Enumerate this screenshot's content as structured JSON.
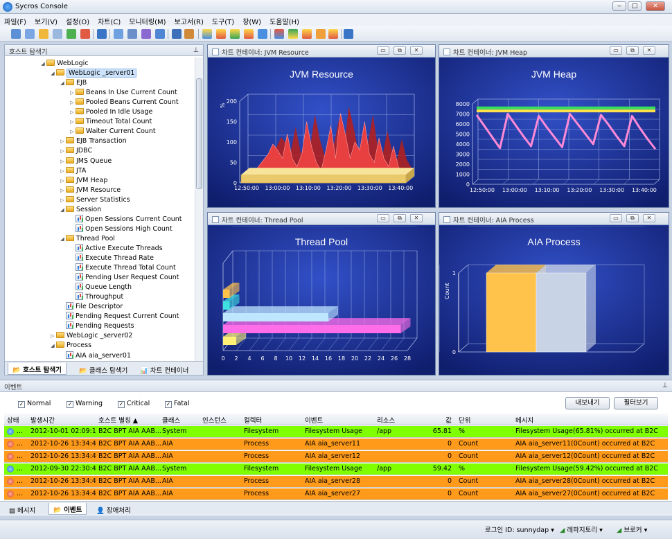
{
  "window": {
    "title": "Sycros Console"
  },
  "menu": [
    "파일(F)",
    "보기(V)",
    "설정(O)",
    "차트(C)",
    "모니터링(M)",
    "보고서(R)",
    "도구(T)",
    "창(W)",
    "도움말(H)"
  ],
  "host_panel": {
    "title": "호스트 탐색기",
    "tree": [
      {
        "label": "WebLogic",
        "depth": 0,
        "arrow": "◢",
        "icon": "folder"
      },
      {
        "label": "WebLogic _server01",
        "depth": 1,
        "arrow": "◢",
        "icon": "folder",
        "selected": true
      },
      {
        "label": "EJB",
        "depth": 2,
        "arrow": "◢",
        "icon": "folder"
      },
      {
        "label": "Beans In Use Current Count",
        "depth": 3,
        "arrow": "▷",
        "icon": "folder"
      },
      {
        "label": "Pooled Beans Current Count",
        "depth": 3,
        "arrow": "▷",
        "icon": "folder"
      },
      {
        "label": "Pooled In Idle Usage",
        "depth": 3,
        "arrow": "▷",
        "icon": "folder"
      },
      {
        "label": "Timeout Total Count",
        "depth": 3,
        "arrow": "▷",
        "icon": "folder"
      },
      {
        "label": "Waiter Current Count",
        "depth": 3,
        "arrow": "▷",
        "icon": "folder"
      },
      {
        "label": "EJB Transaction",
        "depth": 2,
        "arrow": "▷",
        "icon": "folder"
      },
      {
        "label": "JDBC",
        "depth": 2,
        "arrow": "▷",
        "icon": "folder"
      },
      {
        "label": "JMS Queue",
        "depth": 2,
        "arrow": "▷",
        "icon": "folder"
      },
      {
        "label": "JTA",
        "depth": 2,
        "arrow": "▷",
        "icon": "folder"
      },
      {
        "label": "JVM Heap",
        "depth": 2,
        "arrow": "▷",
        "icon": "folder"
      },
      {
        "label": "JVM Resource",
        "depth": 2,
        "arrow": "▷",
        "icon": "folder"
      },
      {
        "label": "Server Statistics",
        "depth": 2,
        "arrow": "▷",
        "icon": "folder"
      },
      {
        "label": "Session",
        "depth": 2,
        "arrow": "◢",
        "icon": "folder"
      },
      {
        "label": "Open Sessions Current Count",
        "depth": 3,
        "arrow": "",
        "icon": "chart"
      },
      {
        "label": "Open Sessions High Count",
        "depth": 3,
        "arrow": "",
        "icon": "chart"
      },
      {
        "label": "Thread Pool",
        "depth": 2,
        "arrow": "◢",
        "icon": "folder"
      },
      {
        "label": "Active Execute Threads",
        "depth": 3,
        "arrow": "",
        "icon": "chart"
      },
      {
        "label": "Execute Thread Rate",
        "depth": 3,
        "arrow": "",
        "icon": "chart"
      },
      {
        "label": "Execute Thread Total Count",
        "depth": 3,
        "arrow": "",
        "icon": "chart"
      },
      {
        "label": "Pending User Request Count",
        "depth": 3,
        "arrow": "",
        "icon": "chart"
      },
      {
        "label": "Queue Length",
        "depth": 3,
        "arrow": "",
        "icon": "chart"
      },
      {
        "label": "Throughput",
        "depth": 3,
        "arrow": "",
        "icon": "chart"
      },
      {
        "label": "File Descriptor",
        "depth": 2,
        "arrow": "",
        "icon": "chart"
      },
      {
        "label": "Pending Request Current Count",
        "depth": 2,
        "arrow": "",
        "icon": "chart"
      },
      {
        "label": "Pending Requests",
        "depth": 2,
        "arrow": "",
        "icon": "chart"
      },
      {
        "label": "WebLogic _server02",
        "depth": 1,
        "arrow": "▷",
        "icon": "folder"
      },
      {
        "label": "Process",
        "depth": 1,
        "arrow": "◢",
        "icon": "folder"
      },
      {
        "label": "AIA aia_server01",
        "depth": 2,
        "arrow": "",
        "icon": "chart"
      }
    ],
    "tabs": [
      "호스트 탐색기",
      "클래스 탐색기",
      "차트 컨테이너"
    ]
  },
  "charts": {
    "jvm_resource": {
      "panel_title": "차트 컨테이너: JVM Resource",
      "title": "JVM Resource"
    },
    "jvm_heap": {
      "panel_title": "차트 컨테이너: JVM Heap",
      "title": "JVM Heap"
    },
    "thread_pool": {
      "panel_title": "차트 컨테이너: Thread Pool",
      "title": "Thread Pool"
    },
    "aia_process": {
      "panel_title": "차트 컨테이너: AIA Process",
      "title": "AIA Process"
    }
  },
  "chart_data": [
    {
      "type": "area",
      "title": "JVM Resource",
      "ylabel": "%",
      "ylim": [
        0,
        200
      ],
      "yticks": [
        0,
        50,
        100,
        150,
        200
      ],
      "xticks": [
        "12:50:00",
        "13:00:00",
        "13:10:00",
        "13:20:00",
        "13:30:00",
        "13:40:00"
      ],
      "series": [
        {
          "values": [
            8,
            14,
            22,
            40,
            55,
            70,
            95,
            80,
            60,
            120,
            60,
            40,
            70,
            150,
            90,
            50,
            30,
            80,
            140,
            60,
            170,
            120,
            60,
            100,
            80,
            150,
            70,
            50,
            110,
            60,
            40,
            90,
            40,
            20
          ]
        },
        {
          "values": [
            20,
            20,
            20,
            20,
            20,
            20,
            20,
            20,
            20,
            20,
            20,
            20,
            20,
            20,
            20,
            20,
            20,
            20,
            20,
            20,
            20,
            20,
            20,
            20,
            20,
            20,
            20,
            20,
            20,
            20,
            20,
            20,
            20,
            20
          ]
        }
      ],
      "colors": [
        "#e84040",
        "#e9c96a"
      ]
    },
    {
      "type": "line",
      "title": "JVM Heap",
      "ylim": [
        0,
        8000
      ],
      "yticks": [
        0,
        1000,
        2000,
        3000,
        4000,
        5000,
        6000,
        7000,
        8000
      ],
      "xticks": [
        "12:50:00",
        "13:00:00",
        "13:10:00",
        "13:20:00",
        "13:30:00",
        "13:40:00"
      ],
      "series": [
        {
          "values": [
            7600,
            7600,
            7600,
            7600,
            7600,
            7600,
            7600,
            7600,
            7600,
            7600,
            7600,
            7600,
            7600,
            7600,
            7600,
            7600,
            7600,
            7600,
            7600,
            7600,
            7600,
            7600,
            7600,
            7600
          ]
        },
        {
          "values": [
            7300,
            7300,
            7300,
            7300,
            7300,
            7300,
            7300,
            7300,
            7300,
            7300,
            7300,
            7300,
            7300,
            7300,
            7300,
            7300,
            7300,
            7300,
            7300,
            7300,
            7300,
            7300,
            7300,
            7300
          ]
        },
        {
          "values": [
            6900,
            5800,
            4700,
            3600,
            7000,
            5900,
            4800,
            3800,
            6800,
            5700,
            4700,
            3700,
            7000,
            6000,
            5000,
            4000,
            6900,
            5900,
            4800,
            3800,
            6800,
            5600,
            4500,
            3500
          ]
        }
      ],
      "colors": [
        "#3adf5a",
        "#ffe14a",
        "#ff8ad6"
      ]
    },
    {
      "type": "bar",
      "title": "Thread Pool",
      "orientation": "horizontal",
      "xlim": [
        0,
        28
      ],
      "xticks": [
        0,
        2,
        4,
        6,
        8,
        10,
        12,
        14,
        16,
        18,
        20,
        22,
        24,
        26,
        28
      ],
      "values": [
        2,
        27,
        16,
        1,
        1
      ],
      "colors": [
        "#fff176",
        "#ff6ee8",
        "#bfe6ff",
        "#40e0e0",
        "#ffc24a"
      ]
    },
    {
      "type": "bar",
      "title": "AIA Process",
      "ylabel": "Count",
      "ylim": [
        0,
        1
      ],
      "categories": [
        "",
        ""
      ],
      "values": [
        1,
        1
      ],
      "colors": [
        "#ffc24a",
        "#c9d3e6"
      ]
    }
  ],
  "events": {
    "panel_title": "이벤트",
    "filters": [
      {
        "label": "Normal",
        "checked": true
      },
      {
        "label": "Warning",
        "checked": true
      },
      {
        "label": "Critical",
        "checked": true
      },
      {
        "label": "Fatal",
        "checked": true
      }
    ],
    "export_label": "내보내기",
    "filter_label": "필터보기",
    "columns": [
      "상태",
      "발생시간",
      "호스트 별칭",
      "클래스",
      "인스턴스",
      "컬렉터",
      "이벤트",
      "리소스",
      "값",
      "단위",
      "메시지"
    ],
    "rows": [
      {
        "color": "#7fff00",
        "status": "normal",
        "time": "2012-10-01 02:09:19",
        "host": "B2C BPT AIA AAB...",
        "class": "System",
        "instance": "",
        "collector": "Filesystem",
        "event": "Filesystem Usage",
        "resource": "/app",
        "value": "65.81",
        "unit": "%",
        "message": "Filesystem Usage(65.81%) occurred at B2C"
      },
      {
        "color": "#ff9a1a",
        "status": "warning",
        "time": "2012-10-26 13:34:46",
        "host": "B2C BPT AIA AAB...",
        "class": "AIA",
        "instance": "",
        "collector": "Process",
        "event": "AIA aia_server11",
        "resource": "",
        "value": "0",
        "unit": "Count",
        "message": "AIA aia_server11(0Count) occurred at B2C"
      },
      {
        "color": "#ff9a1a",
        "status": "warning",
        "time": "2012-10-26 13:34:46",
        "host": "B2C BPT AIA AAB...",
        "class": "AIA",
        "instance": "",
        "collector": "Process",
        "event": "AIA aia_server12",
        "resource": "",
        "value": "0",
        "unit": "Count",
        "message": "AIA aia_server12(0Count) occurred at B2C"
      },
      {
        "color": "#7fff00",
        "status": "normal",
        "time": "2012-09-30 22:30:42",
        "host": "B2C BPT AIA AAB...",
        "class": "System",
        "instance": "",
        "collector": "Filesystem",
        "event": "Filesystem Usage",
        "resource": "/app",
        "value": "59.42",
        "unit": "%",
        "message": "Filesystem Usage(59.42%) occurred at B2C"
      },
      {
        "color": "#ff9a1a",
        "status": "warning",
        "time": "2012-10-26 13:34:46",
        "host": "B2C BPT AIA AAB...",
        "class": "AIA",
        "instance": "",
        "collector": "Process",
        "event": "AIA aia_server28",
        "resource": "",
        "value": "0",
        "unit": "Count",
        "message": "AIA aia_server28(0Count) occurred at B2C"
      },
      {
        "color": "#ff9a1a",
        "status": "warning",
        "time": "2012-10-26 13:34:46",
        "host": "B2C BPT AIA AAB...",
        "class": "AIA",
        "instance": "",
        "collector": "Process",
        "event": "AIA aia_server27",
        "resource": "",
        "value": "0",
        "unit": "Count",
        "message": "AIA aia_server27(0Count) occurred at B2C"
      }
    ],
    "tabs": [
      "메시지",
      "이벤트",
      "장애처리"
    ]
  },
  "status": {
    "login": "로그인 ID: sunnydap",
    "repository": "레파지토리",
    "broker": "브로커"
  }
}
